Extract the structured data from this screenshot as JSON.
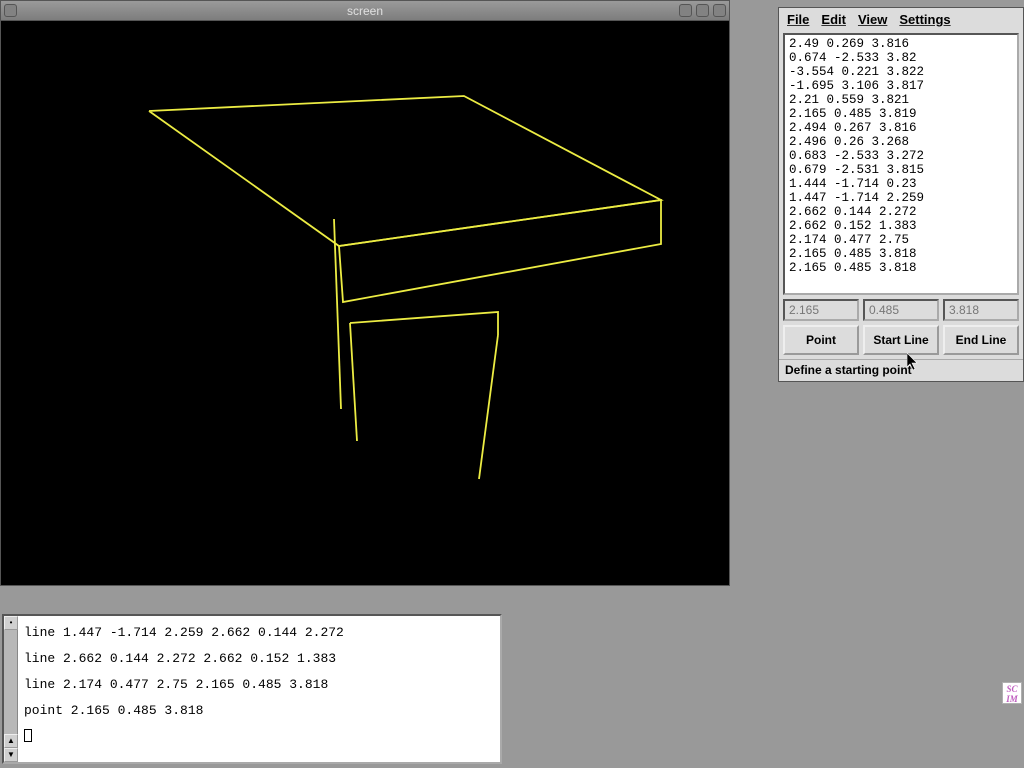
{
  "screen": {
    "title": "screen"
  },
  "tool": {
    "menu": {
      "file": "File",
      "edit": "Edit",
      "view": "View",
      "settings": "Settings"
    },
    "coords": [
      "2.49 0.269 3.816",
      "0.674 -2.533 3.82",
      "-3.554 0.221 3.822",
      "-1.695 3.106 3.817",
      "2.21 0.559 3.821",
      "2.165 0.485 3.819",
      "2.494 0.267 3.816",
      "2.496 0.26 3.268",
      "0.683 -2.533 3.272",
      "0.679 -2.531 3.815",
      "1.444 -1.714 0.23",
      "1.447 -1.714 2.259",
      "2.662 0.144 2.272",
      "2.662 0.152 1.383",
      "2.174 0.477 2.75",
      "2.165 0.485 3.818",
      "2.165 0.485 3.818"
    ],
    "fields": {
      "x": "2.165",
      "y": "0.485",
      "z": "3.818"
    },
    "buttons": {
      "point": "Point",
      "start": "Start Line",
      "end": "End Line"
    },
    "status": "Define a starting point"
  },
  "console": {
    "lines": [
      "line 1.447 -1.714 2.259 2.662 0.144 2.272",
      "line 2.662 0.144 2.272 2.662 0.152 1.383",
      "line 2.174 0.477 2.75 2.165 0.485 3.818",
      "point 2.165 0.485 3.818"
    ]
  },
  "scim": "SC\nIM"
}
